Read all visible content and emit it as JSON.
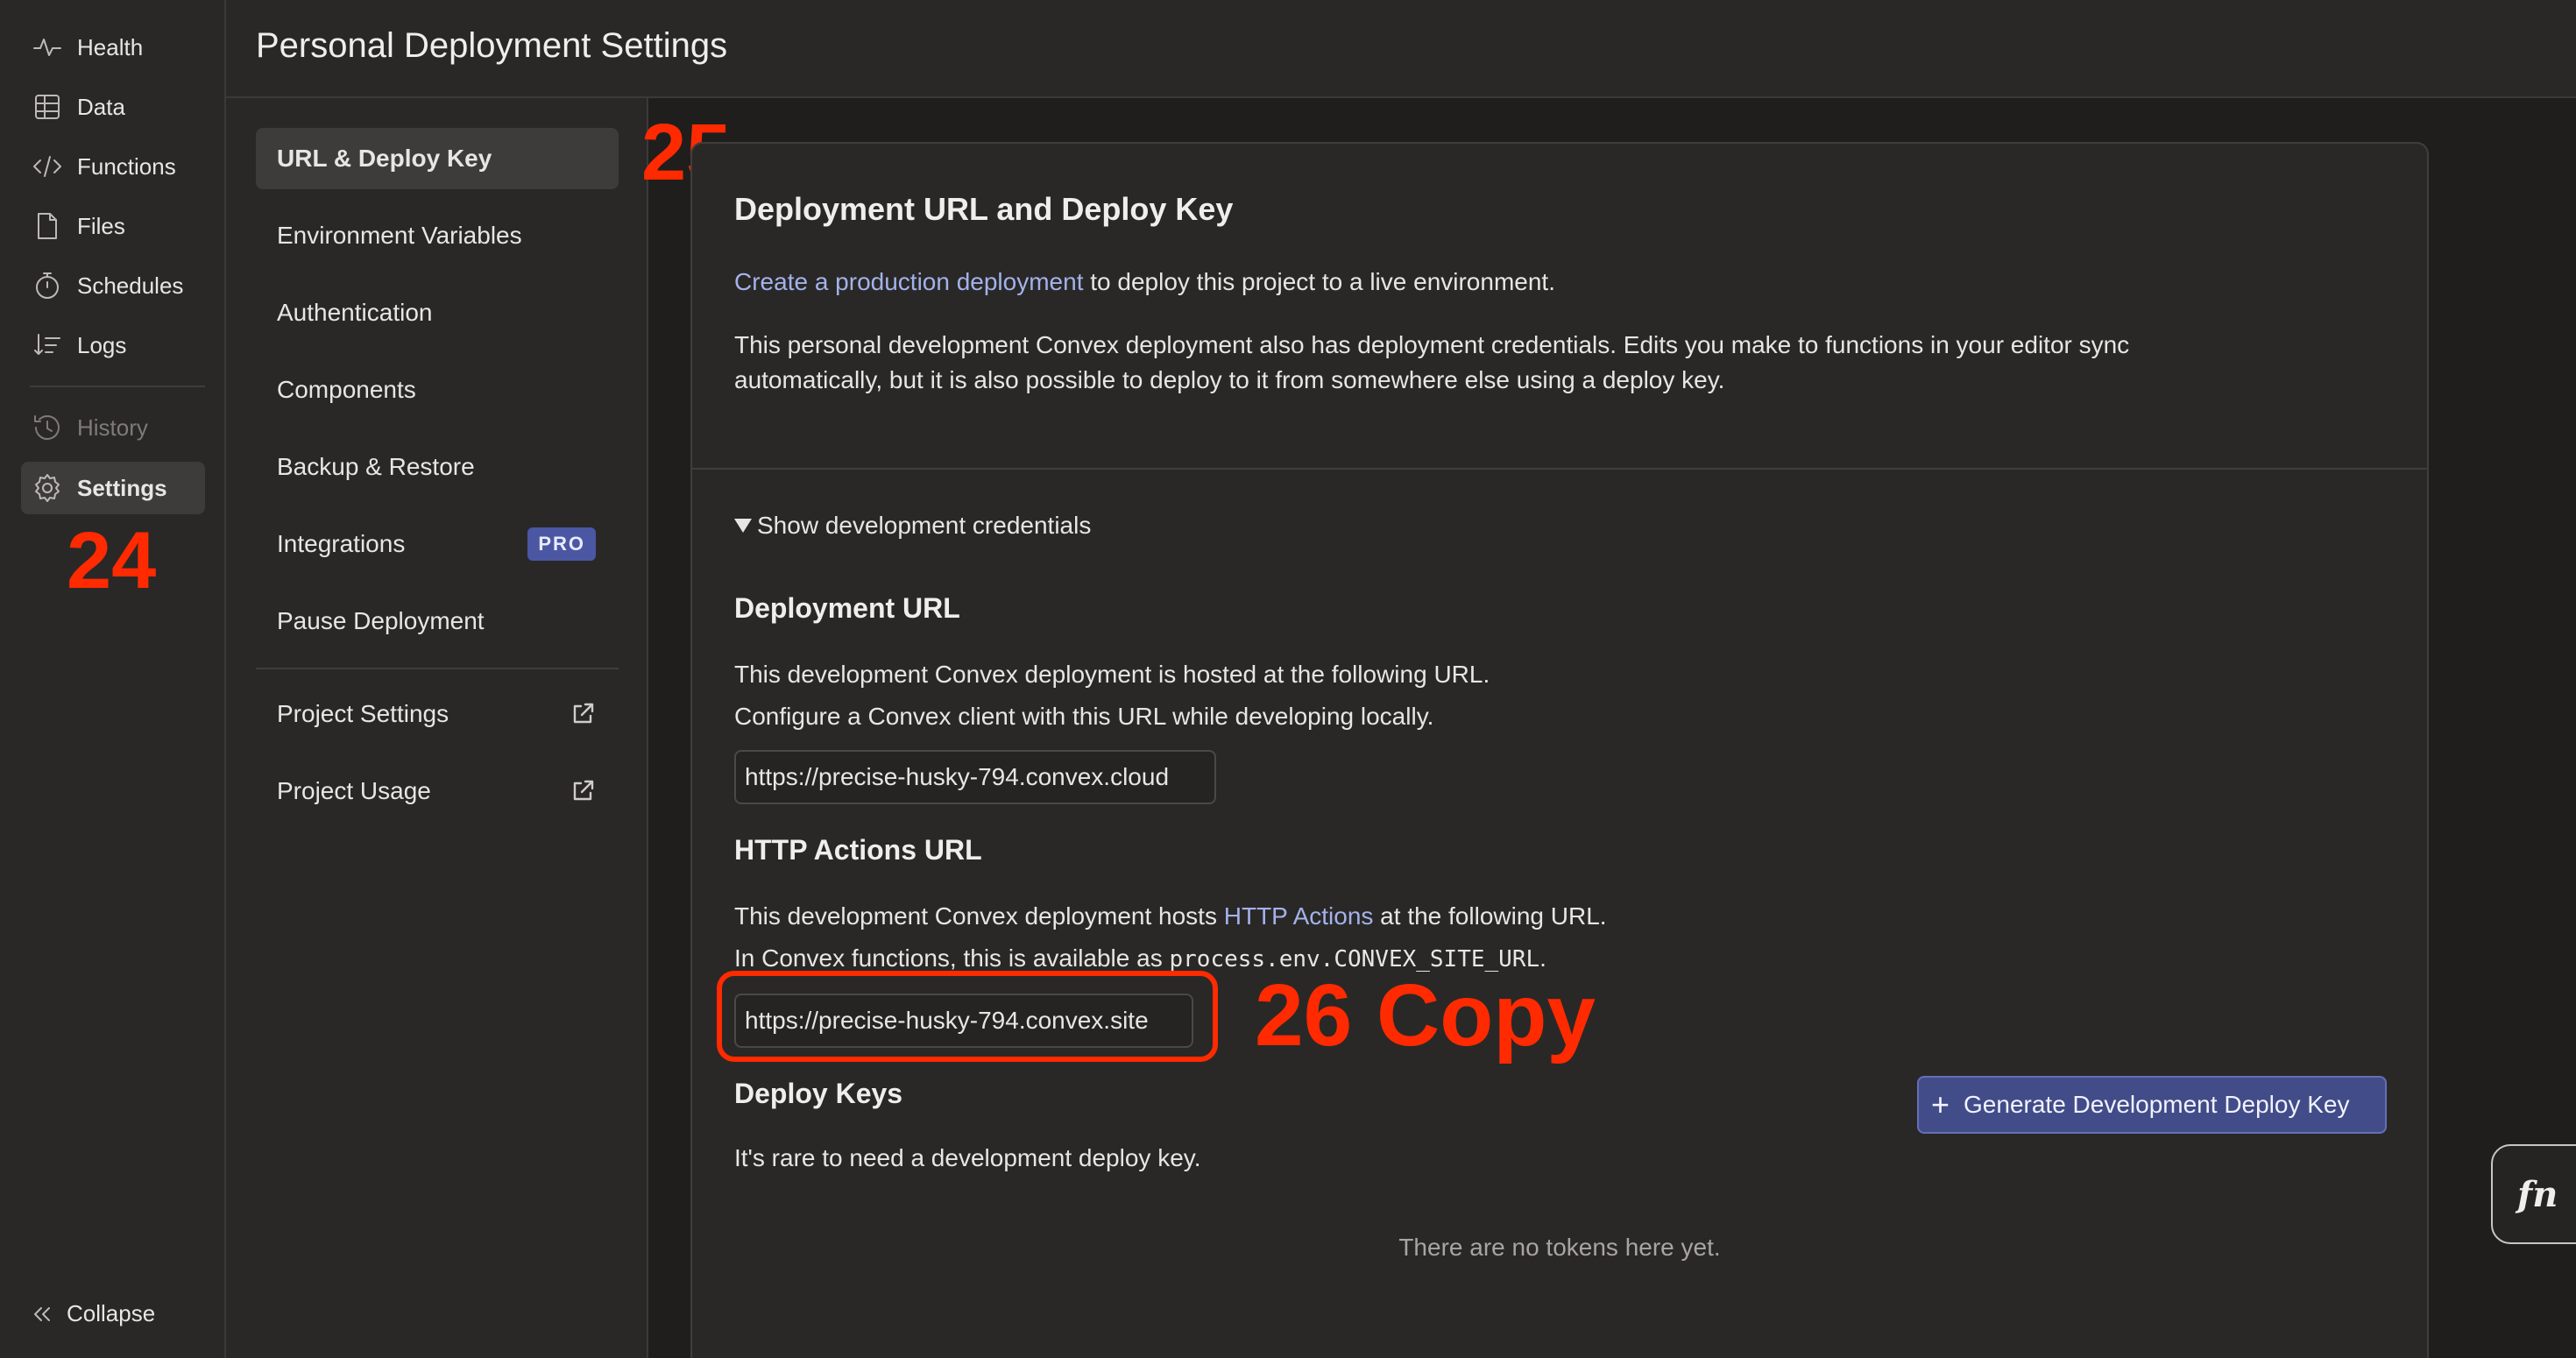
{
  "nav": {
    "items": [
      {
        "label": "Health",
        "icon": "health-icon"
      },
      {
        "label": "Data",
        "icon": "table-icon"
      },
      {
        "label": "Functions",
        "icon": "code-icon"
      },
      {
        "label": "Files",
        "icon": "file-icon"
      },
      {
        "label": "Schedules",
        "icon": "stopwatch-icon"
      },
      {
        "label": "Logs",
        "icon": "logs-icon"
      },
      {
        "label": "History",
        "icon": "history-icon"
      },
      {
        "label": "Settings",
        "icon": "gear-icon"
      }
    ],
    "collapse_label": "Collapse"
  },
  "header": {
    "title": "Personal Deployment Settings"
  },
  "subnav": {
    "items": [
      {
        "label": "URL & Deploy Key"
      },
      {
        "label": "Environment Variables"
      },
      {
        "label": "Authentication"
      },
      {
        "label": "Components"
      },
      {
        "label": "Backup & Restore"
      },
      {
        "label": "Integrations",
        "badge": "PRO"
      },
      {
        "label": "Pause Deployment"
      },
      {
        "label": "Project Settings"
      },
      {
        "label": "Project Usage"
      }
    ]
  },
  "main": {
    "title": "Deployment URL and Deploy Key",
    "create_link": "Create a production deployment",
    "create_rest": " to deploy this project to a live environment.",
    "description": "This personal development Convex deployment also has deployment credentials. Edits you make to functions in your editor sync automatically, but it is also possible to deploy to it from somewhere else using a deploy key.",
    "toggle_label": "Show development credentials",
    "deployment_url": {
      "heading": "Deployment URL",
      "line1": "This development Convex deployment is hosted at the following URL.",
      "line2": "Configure a Convex client with this URL while developing locally.",
      "value": "https://precise-husky-794.convex.cloud"
    },
    "http_actions": {
      "heading": "HTTP Actions URL",
      "line1_pre": "This development Convex deployment hosts ",
      "line1_link": "HTTP Actions",
      "line1_post": " at the following URL.",
      "line2_pre": "In Convex functions, this is available as ",
      "line2_code": "process.env.CONVEX_SITE_URL",
      "line2_post": ".",
      "value": "https://precise-husky-794.convex.site"
    },
    "deploy_keys": {
      "heading": "Deploy Keys",
      "note": "It's rare to need a development deploy key.",
      "generate_button": "Generate Development Deploy Key",
      "empty": "There are no tokens here yet."
    }
  },
  "fn_button": "fn",
  "annotations": {
    "a24": "24",
    "a25": "25",
    "a26": "26 Copy"
  }
}
